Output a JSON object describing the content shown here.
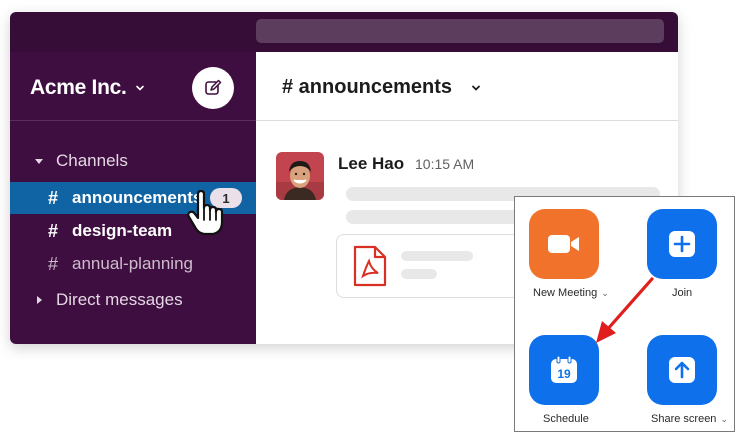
{
  "workspace": {
    "name": "Acme Inc."
  },
  "sidebar": {
    "sections": [
      {
        "label": "Channels",
        "expanded": true
      },
      {
        "label": "Direct messages",
        "expanded": false
      }
    ],
    "channels": [
      {
        "hash": "#",
        "name": "announcements",
        "active": true,
        "unread_count": "1"
      },
      {
        "hash": "#",
        "name": "design-team",
        "bold": true
      },
      {
        "hash": "#",
        "name": "annual-planning"
      }
    ]
  },
  "channel": {
    "title": "# announcements"
  },
  "message": {
    "author": "Lee Hao",
    "time": "10:15 AM"
  },
  "zoom": {
    "buttons": [
      {
        "label": "New Meeting",
        "has_dropdown": true,
        "icon": "video-camera-icon",
        "color": "#f0722b"
      },
      {
        "label": "Join",
        "icon": "plus-icon",
        "color": "#0e71eb"
      },
      {
        "label": "Schedule",
        "icon": "calendar-icon",
        "calendar_day": "19",
        "color": "#0e71eb"
      },
      {
        "label": "Share screen",
        "has_dropdown": true,
        "icon": "upload-arrow-icon",
        "color": "#0e71eb"
      }
    ]
  },
  "colors": {
    "sidebar": "#3f0e40",
    "topbar": "#350d36",
    "active_channel": "#1164a3",
    "annotation_arrow": "#e01e1e"
  }
}
